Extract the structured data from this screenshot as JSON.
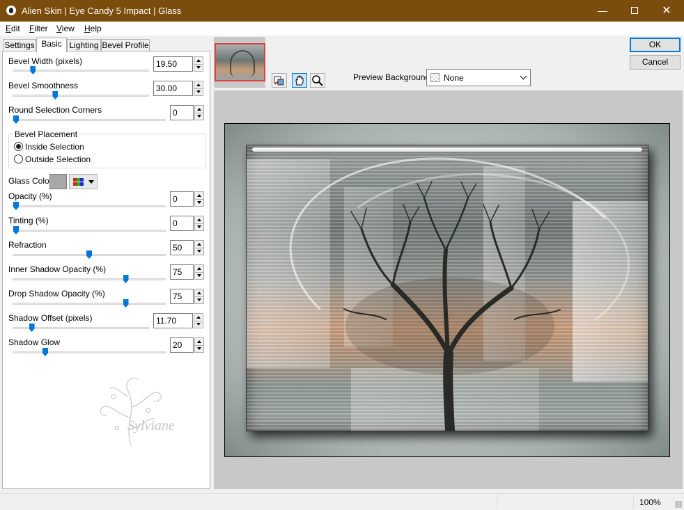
{
  "window": {
    "title": "Alien Skin | Eye Candy 5 Impact | Glass",
    "app_icon": "alien-skin-icon"
  },
  "menu": [
    {
      "label": "Edit",
      "mnemonic": "E",
      "rest": "dit"
    },
    {
      "label": "Filter",
      "mnemonic": "F",
      "rest": "ilter"
    },
    {
      "label": "View",
      "mnemonic": "V",
      "rest": "iew"
    },
    {
      "label": "Help",
      "mnemonic": "H",
      "rest": "elp"
    }
  ],
  "tabs": [
    "Settings",
    "Basic",
    "Lighting",
    "Bevel Profile"
  ],
  "active_tab": "Basic",
  "controls": {
    "bevel_width": {
      "label": "Bevel Width (pixels)",
      "value": "19.50",
      "level": 0.13
    },
    "bevel_smoothness": {
      "label": "Bevel Smoothness",
      "value": "30.00",
      "level": 0.3
    },
    "round_corners": {
      "label": "Round Selection Corners",
      "value": "0",
      "level": 0.0
    },
    "bevel_placement": {
      "label": "Bevel Placement",
      "inside": "Inside Selection",
      "outside": "Outside Selection",
      "selected": "inside"
    },
    "glass_color": {
      "label": "Glass Color",
      "color": "#a7a7a7"
    },
    "opacity": {
      "label": "Opacity (%)",
      "value": "0",
      "level": 0.0
    },
    "tinting": {
      "label": "Tinting (%)",
      "value": "0",
      "level": 0.0
    },
    "refraction": {
      "label": "Refraction",
      "value": "50",
      "level": 0.5
    },
    "inner_shadow_opacity": {
      "label": "Inner Shadow Opacity (%)",
      "value": "75",
      "level": 0.75
    },
    "drop_shadow_opacity": {
      "label": "Drop Shadow Opacity (%)",
      "value": "75",
      "level": 0.75
    },
    "shadow_offset": {
      "label": "Shadow Offset (pixels)",
      "value": "11.70",
      "level": 0.12
    },
    "shadow_glow": {
      "label": "Shadow Glow",
      "value": "20",
      "level": 0.2
    }
  },
  "watermark": {
    "text": "Sylviane"
  },
  "toolbar": {
    "icons": [
      "compare-icon",
      "hand-pan-icon",
      "zoom-icon"
    ]
  },
  "preview_background": {
    "label": "Preview Background:",
    "value": "None"
  },
  "buttons": {
    "ok": "OK",
    "cancel": "Cancel"
  },
  "status": {
    "zoom": "100%"
  },
  "colors": {
    "titlebar": "#7a4d0c",
    "accent": "#0078d7"
  }
}
